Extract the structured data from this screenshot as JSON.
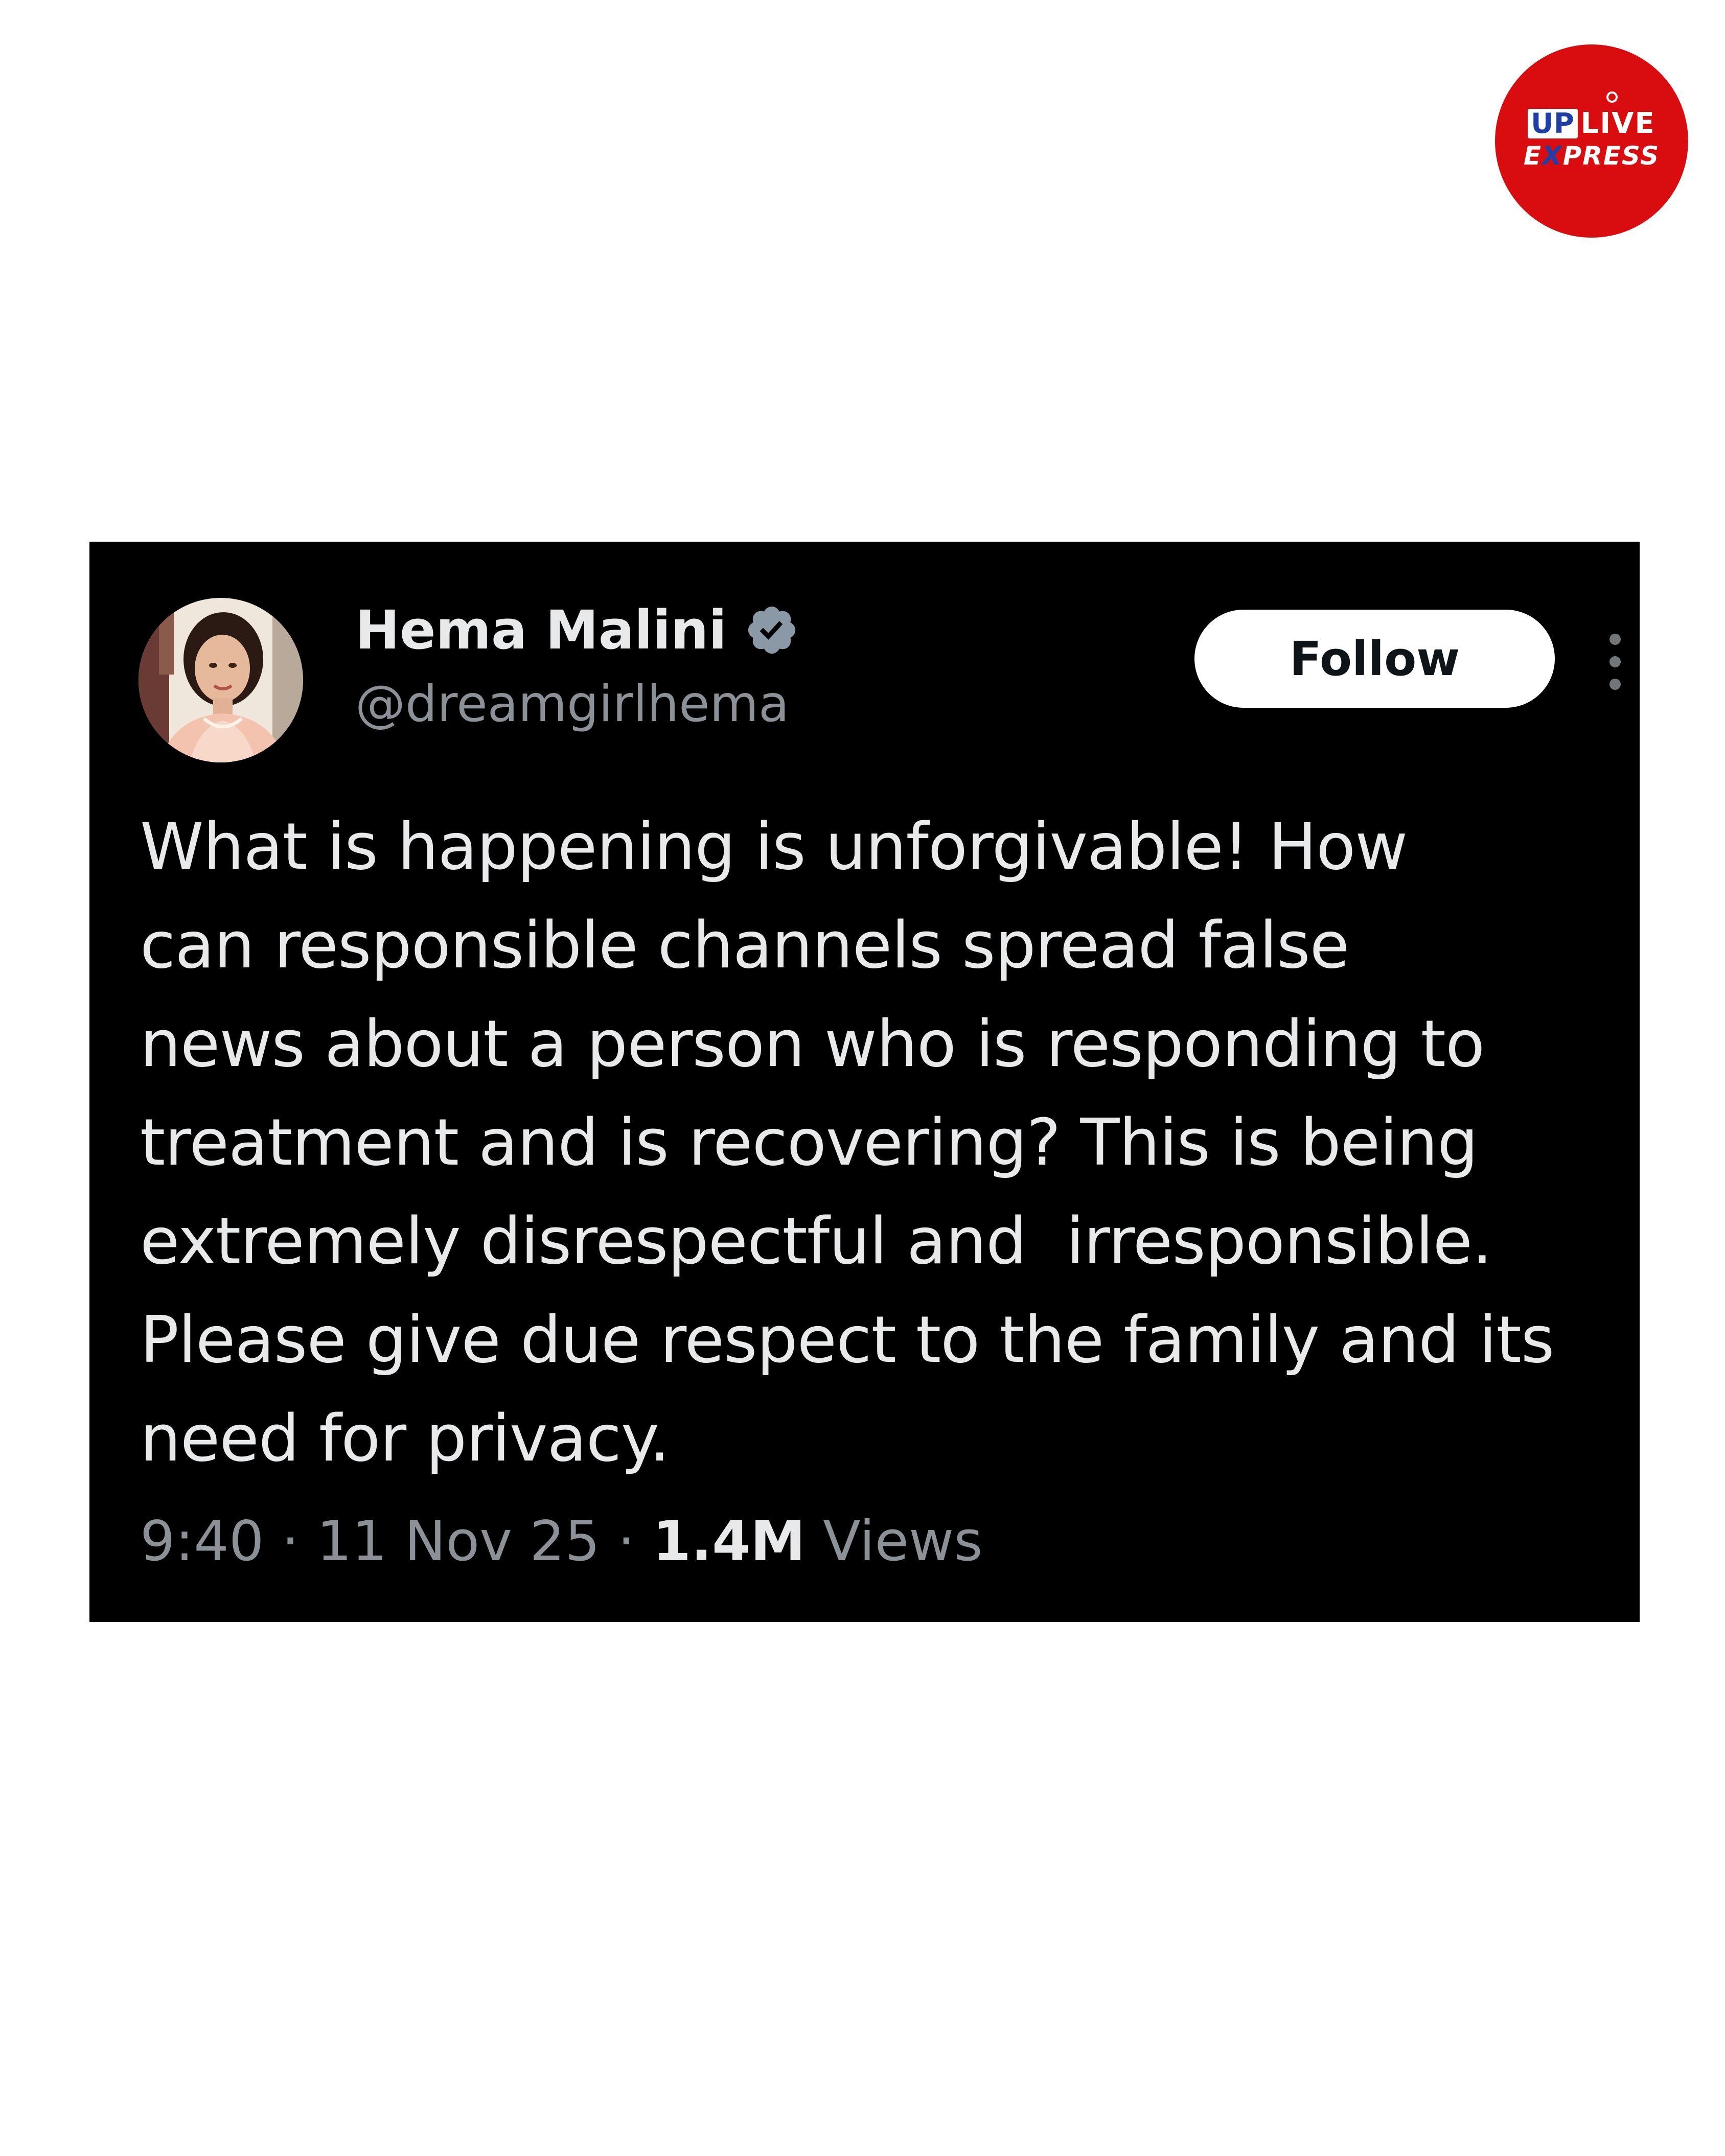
{
  "logo": {
    "line1_up": "UP",
    "line1_live": "LIVE",
    "line2_pre": "E",
    "line2_x": "X",
    "line2_post": "PRESS",
    "colors": {
      "background": "#d90d0f",
      "accent": "#1f3fa8"
    }
  },
  "tweet": {
    "author_name": "Hema Malini",
    "handle": "@dreamgirlhema",
    "verified_icon": "verified-badge-icon",
    "follow_label": "Follow",
    "more_icon": "more-vertical-icon",
    "text_lines": [
      "What is happening is unforgivable! How",
      "can responsible channels spread false",
      "news about a person who is responding to",
      "treatment and is recovering? This is being",
      "extremely disrespectful and  irresponsible.",
      "Please give due respect to the family and its",
      "need for privacy."
    ],
    "time": "9:40",
    "date": "11 Nov 25",
    "separator": "·",
    "views_count": "1.4M",
    "views_label": "Views",
    "colors": {
      "card_background": "#000000",
      "text": "#e7e9ea",
      "secondary": "#8b9196",
      "verified": "#8b98a5"
    }
  }
}
